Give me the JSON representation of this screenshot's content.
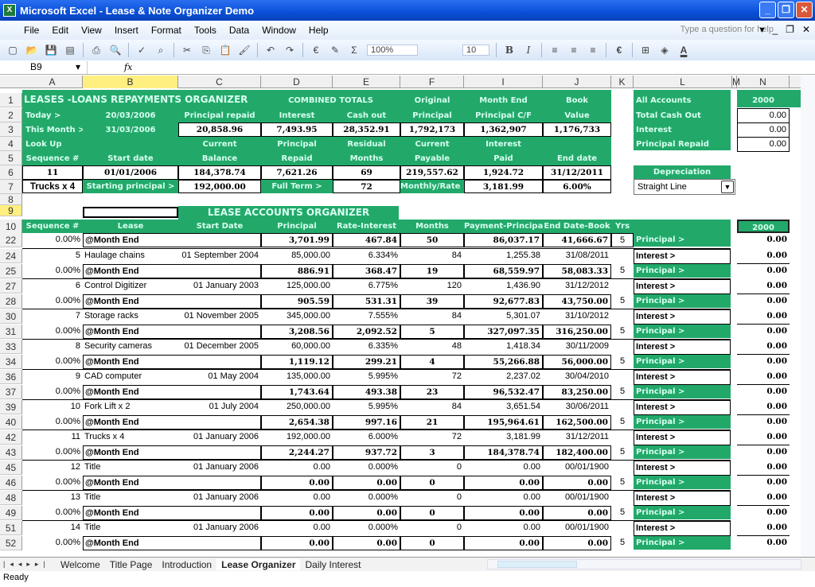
{
  "window": {
    "title": "Microsoft Excel - Lease & Note Organizer Demo",
    "controls": [
      "minimize",
      "restore",
      "close"
    ]
  },
  "menu": {
    "items": [
      "File",
      "Edit",
      "View",
      "Insert",
      "Format",
      "Tools",
      "Data",
      "Window",
      "Help"
    ],
    "help_placeholder": "Type a question for help"
  },
  "toolbar": {
    "zoom": "100%",
    "font_size": "10",
    "bold": "B",
    "italic": "I",
    "euro": "€",
    "sum": "Σ"
  },
  "formula_bar": {
    "name_box": "B9",
    "fx": "fx",
    "content": ""
  },
  "columns": [
    "A",
    "B",
    "C",
    "D",
    "E",
    "F",
    "I",
    "J",
    "K",
    "L",
    "M",
    "N"
  ],
  "selected_column": "B",
  "summary": {
    "title": "LEASES -LOANS REPAYMENTS ORGANIZER",
    "combined_totals": "COMBINED TOTALS",
    "today_label": "Today >",
    "today": "20/03/2006",
    "this_month_label": "This Month >",
    "this_month": "31/03/2006",
    "headers_row1": [
      "Original",
      "Month End",
      "Book"
    ],
    "headers_row2": [
      "Principal repaid",
      "Interest",
      "Cash out",
      "Principal",
      "Principal C/F",
      "Value"
    ],
    "totals": [
      "20,858.96",
      "7,493.95",
      "28,352.91",
      "1,792,173",
      "1,362,907",
      "1,176,733"
    ],
    "lookup_label": "Look Up",
    "lookup_h1": [
      "Current",
      "Principal",
      "Residual",
      "Current",
      "Interest"
    ],
    "lookup_h2": [
      "Sequence #",
      "Start date",
      "Balance",
      "Repaid",
      "Months",
      "Payable",
      "Paid",
      "End date"
    ],
    "lookup_values": [
      "11",
      "01/01/2006",
      "184,378.74",
      "7,621.26",
      "69",
      "219,557.62",
      "1,924.72",
      "31/12/2011"
    ],
    "lease_name": "Trucks x 4",
    "starting_principal_label": "Starting principal >",
    "starting_principal": "192,000.00",
    "full_term_label": "Full Term >",
    "full_term": "72",
    "monthly_rate_label": "Monthly/Rate >",
    "monthly_payment": "3,181.99",
    "rate": "6.00%"
  },
  "all_accounts": {
    "title": "All Accounts",
    "year": "2000",
    "rows": [
      {
        "label": "Total Cash Out",
        "value": "0.00"
      },
      {
        "label": "Interest",
        "value": "0.00"
      },
      {
        "label": "Principal Repaid",
        "value": "0.00"
      }
    ],
    "depreciation_label": "Depreciation",
    "depreciation_method": "Straight Line"
  },
  "organizer": {
    "title": "LEASE ACCOUNTS ORGANIZER",
    "headers": [
      "Sequence #",
      "Lease",
      "Start Date",
      "Principal",
      "Rate-Interest",
      "Months",
      "Payment-Principal",
      "End Date-Book",
      "Yrs"
    ],
    "year_header": "2000",
    "first_row": {
      "row": "22",
      "pct": "0.00%",
      "label": "@Month End",
      "principal": "3,701.99",
      "interest": "467.84",
      "months": "50",
      "payment": "86,037.17",
      "book": "41,666.67",
      "yrs": "5",
      "tag": "Principal >",
      "year_val": "0.00"
    },
    "leases": [
      {
        "rows": [
          "24",
          "25"
        ],
        "seq": "5",
        "name": "Haulage chains",
        "start": "01 September 2004",
        "principal": "85,000.00",
        "rate": "6.334%",
        "term": "84",
        "payment": "1,255.38",
        "end": "31/08/2011",
        "me_principal": "886.91",
        "me_interest": "368.47",
        "me_months": "19",
        "me_payment": "68,559.97",
        "me_book": "58,083.33",
        "yrs": "5",
        "pct": "0.00%"
      },
      {
        "rows": [
          "27",
          "28"
        ],
        "seq": "6",
        "name": "Control Digitizer",
        "start": "01 January 2003",
        "principal": "125,000.00",
        "rate": "6.775%",
        "term": "120",
        "payment": "1,436.90",
        "end": "31/12/2012",
        "me_principal": "905.59",
        "me_interest": "531.31",
        "me_months": "39",
        "me_payment": "92,677.83",
        "me_book": "43,750.00",
        "yrs": "5",
        "pct": "0.00%"
      },
      {
        "rows": [
          "30",
          "31"
        ],
        "seq": "7",
        "name": "Storage racks",
        "start": "01 November 2005",
        "principal": "345,000.00",
        "rate": "7.555%",
        "term": "84",
        "payment": "5,301.07",
        "end": "31/10/2012",
        "me_principal": "3,208.56",
        "me_interest": "2,092.52",
        "me_months": "5",
        "me_payment": "327,097.35",
        "me_book": "316,250.00",
        "yrs": "5",
        "pct": "0.00%"
      },
      {
        "rows": [
          "33",
          "34"
        ],
        "seq": "8",
        "name": "Security cameras",
        "start": "01 December 2005",
        "principal": "60,000.00",
        "rate": "6.335%",
        "term": "48",
        "payment": "1,418.34",
        "end": "30/11/2009",
        "me_principal": "1,119.12",
        "me_interest": "299.21",
        "me_months": "4",
        "me_payment": "55,266.88",
        "me_book": "56,000.00",
        "yrs": "5",
        "pct": "0.00%"
      },
      {
        "rows": [
          "36",
          "37"
        ],
        "seq": "9",
        "name": "CAD computer",
        "start": "01 May 2004",
        "principal": "135,000.00",
        "rate": "5.995%",
        "term": "72",
        "payment": "2,237.02",
        "end": "30/04/2010",
        "me_principal": "1,743.64",
        "me_interest": "493.38",
        "me_months": "23",
        "me_payment": "96,532.47",
        "me_book": "83,250.00",
        "yrs": "5",
        "pct": "0.00%"
      },
      {
        "rows": [
          "39",
          "40"
        ],
        "seq": "10",
        "name": "Fork Lift x 2",
        "start": "01 July 2004",
        "principal": "250,000.00",
        "rate": "5.995%",
        "term": "84",
        "payment": "3,651.54",
        "end": "30/06/2011",
        "me_principal": "2,654.38",
        "me_interest": "997.16",
        "me_months": "21",
        "me_payment": "195,964.61",
        "me_book": "162,500.00",
        "yrs": "5",
        "pct": "0.00%"
      },
      {
        "rows": [
          "42",
          "43"
        ],
        "seq": "11",
        "name": "Trucks x 4",
        "start": "01 January 2006",
        "principal": "192,000.00",
        "rate": "6.000%",
        "term": "72",
        "payment": "3,181.99",
        "end": "31/12/2011",
        "me_principal": "2,244.27",
        "me_interest": "937.72",
        "me_months": "3",
        "me_payment": "184,378.74",
        "me_book": "182,400.00",
        "yrs": "5",
        "pct": "0.00%"
      },
      {
        "rows": [
          "45",
          "46"
        ],
        "seq": "12",
        "name": "Title",
        "start": "01 January 2006",
        "principal": "0.00",
        "rate": "0.000%",
        "term": "0",
        "payment": "0.00",
        "end": "00/01/1900",
        "me_principal": "0.00",
        "me_interest": "0.00",
        "me_months": "0",
        "me_payment": "0.00",
        "me_book": "0.00",
        "yrs": "5",
        "pct": "0.00%"
      },
      {
        "rows": [
          "48",
          "49"
        ],
        "seq": "13",
        "name": "Title",
        "start": "01 January 2006",
        "principal": "0.00",
        "rate": "0.000%",
        "term": "0",
        "payment": "0.00",
        "end": "00/01/1900",
        "me_principal": "0.00",
        "me_interest": "0.00",
        "me_months": "0",
        "me_payment": "0.00",
        "me_book": "0.00",
        "yrs": "5",
        "pct": "0.00%"
      },
      {
        "rows": [
          "51",
          "52"
        ],
        "seq": "14",
        "name": "Title",
        "start": "01 January 2006",
        "principal": "0.00",
        "rate": "0.000%",
        "term": "0",
        "payment": "0.00",
        "end": "00/01/1900",
        "me_principal": "0.00",
        "me_interest": "0.00",
        "me_months": "0",
        "me_payment": "0.00",
        "me_book": "0.00",
        "yrs": "5",
        "pct": "0.00%"
      }
    ],
    "month_end_label": "@Month End",
    "interest_tag": "Interest >",
    "principal_tag": "Principal >",
    "year_value": "0.00"
  },
  "sheet_tabs": [
    "Welcome",
    "Title Page",
    "Introduction",
    "Lease Organizer",
    "Daily Interest"
  ],
  "active_tab": "Lease Organizer",
  "status": "Ready",
  "row_headers_top": [
    "1",
    "2",
    "3",
    "4",
    "5",
    "6",
    "7",
    "8",
    "9",
    "10"
  ]
}
